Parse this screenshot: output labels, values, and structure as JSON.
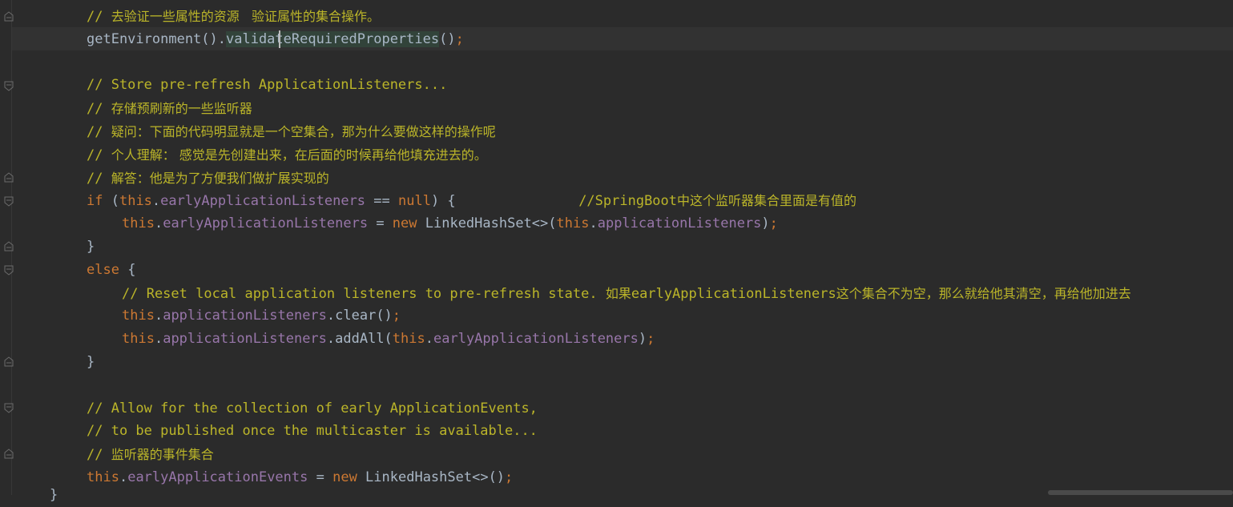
{
  "editor": {
    "lines": [
      {
        "tokens": [
          {
            "t": "// ",
            "k": "c"
          },
          {
            "t": "去验证一些属性的资源   验证属性的集合操作。",
            "k": "c zh"
          }
        ]
      },
      {
        "tokens": [
          {
            "t": "getEnvironment().",
            "k": "plain"
          },
          {
            "t": "validateRequiredProperties",
            "k": "plain hl"
          },
          {
            "t": "()",
            "k": "plain"
          },
          {
            "t": ";",
            "k": "kw"
          }
        ]
      },
      {
        "tokens": []
      },
      {
        "tokens": [
          {
            "t": "// Store pre-refresh ApplicationListeners...",
            "k": "c"
          }
        ]
      },
      {
        "tokens": [
          {
            "t": "// ",
            "k": "c"
          },
          {
            "t": "存储预刷新的一些监听器",
            "k": "c zh"
          }
        ]
      },
      {
        "tokens": [
          {
            "t": "// ",
            "k": "c"
          },
          {
            "t": "疑问：下面的代码明显就是一个空集合，那为什么要做这样的操作呢",
            "k": "c zh"
          }
        ]
      },
      {
        "tokens": [
          {
            "t": "// ",
            "k": "c"
          },
          {
            "t": "个人理解： 感觉是先创建出来，在后面的时候再给他填充进去的。",
            "k": "c zh"
          }
        ]
      },
      {
        "tokens": [
          {
            "t": "// ",
            "k": "c"
          },
          {
            "t": "解答：他是为了方便我们做扩展实现的",
            "k": "c zh"
          }
        ]
      },
      {
        "tokens": [
          {
            "t": "if",
            "k": "kw"
          },
          {
            "t": " (",
            "k": "plain"
          },
          {
            "t": "this",
            "k": "kw"
          },
          {
            "t": ".",
            "k": "plain"
          },
          {
            "t": "earlyApplicationListeners",
            "k": "fld"
          },
          {
            "t": " == ",
            "k": "plain"
          },
          {
            "t": "null",
            "k": "kw"
          },
          {
            "t": ") {               ",
            "k": "plain"
          },
          {
            "t": "//SpringBoot",
            "k": "c"
          },
          {
            "t": "中这个监听器集合里面是有值的",
            "k": "c zh"
          }
        ]
      },
      {
        "indent": 1,
        "tokens": [
          {
            "t": "this",
            "k": "kw"
          },
          {
            "t": ".",
            "k": "plain"
          },
          {
            "t": "earlyApplicationListeners",
            "k": "fld"
          },
          {
            "t": " = ",
            "k": "plain"
          },
          {
            "t": "new",
            "k": "kw"
          },
          {
            "t": " LinkedHashSet<>(",
            "k": "plain"
          },
          {
            "t": "this",
            "k": "kw"
          },
          {
            "t": ".",
            "k": "plain"
          },
          {
            "t": "applicationListeners",
            "k": "fld"
          },
          {
            "t": ")",
            "k": "plain"
          },
          {
            "t": ";",
            "k": "kw"
          }
        ]
      },
      {
        "tokens": [
          {
            "t": "}",
            "k": "plain"
          }
        ]
      },
      {
        "tokens": [
          {
            "t": "else",
            "k": "kw"
          },
          {
            "t": " {",
            "k": "plain"
          }
        ]
      },
      {
        "indent": 1,
        "tokens": [
          {
            "t": "// Reset local application listeners to pre-refresh state. ",
            "k": "c"
          },
          {
            "t": "如果",
            "k": "c zh"
          },
          {
            "t": "earlyApplicationListeners",
            "k": "c"
          },
          {
            "t": "这个集合不为空，那么就给他其清空，再给他加进去",
            "k": "c zh"
          }
        ]
      },
      {
        "indent": 1,
        "tokens": [
          {
            "t": "this",
            "k": "kw"
          },
          {
            "t": ".",
            "k": "plain"
          },
          {
            "t": "applicationListeners",
            "k": "fld"
          },
          {
            "t": ".clear()",
            "k": "plain"
          },
          {
            "t": ";",
            "k": "kw"
          }
        ]
      },
      {
        "indent": 1,
        "tokens": [
          {
            "t": "this",
            "k": "kw"
          },
          {
            "t": ".",
            "k": "plain"
          },
          {
            "t": "applicationListeners",
            "k": "fld"
          },
          {
            "t": ".addAll(",
            "k": "plain"
          },
          {
            "t": "this",
            "k": "kw"
          },
          {
            "t": ".",
            "k": "plain"
          },
          {
            "t": "earlyApplicationListeners",
            "k": "fld"
          },
          {
            "t": ")",
            "k": "plain"
          },
          {
            "t": ";",
            "k": "kw"
          }
        ]
      },
      {
        "tokens": [
          {
            "t": "}",
            "k": "plain"
          }
        ]
      },
      {
        "tokens": []
      },
      {
        "tokens": [
          {
            "t": "// Allow for the collection of early ApplicationEvents,",
            "k": "c"
          }
        ]
      },
      {
        "tokens": [
          {
            "t": "// to be published once the multicaster is available...",
            "k": "c"
          }
        ]
      },
      {
        "tokens": [
          {
            "t": "// ",
            "k": "c"
          },
          {
            "t": "监听器的事件集合",
            "k": "c zh"
          }
        ]
      },
      {
        "tokens": [
          {
            "t": "this",
            "k": "kw"
          },
          {
            "t": ".",
            "k": "plain"
          },
          {
            "t": "earlyApplicationEvents",
            "k": "fld"
          },
          {
            "t": " = ",
            "k": "plain"
          },
          {
            "t": "new",
            "k": "kw"
          },
          {
            "t": " LinkedHashSet<>()",
            "k": "plain"
          },
          {
            "t": ";",
            "k": "kw"
          }
        ]
      }
    ],
    "partial_bottom": "}",
    "colors": {
      "background": "#2b2b2b",
      "comment": "#bbb529",
      "keyword": "#cc7832",
      "field": "#9876aa",
      "text": "#a9b7c6"
    }
  }
}
